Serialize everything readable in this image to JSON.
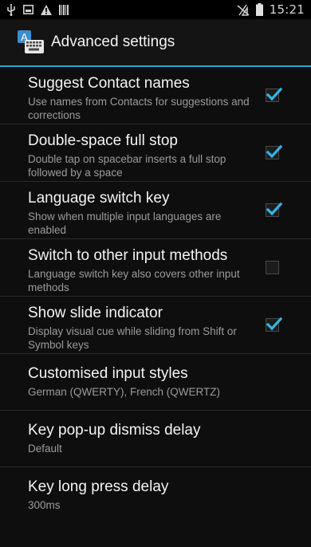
{
  "status_bar": {
    "time": "15:21",
    "icons": [
      "usb-icon",
      "image-icon",
      "warning-icon",
      "barcode-icon",
      "no-signal-icon",
      "battery-icon"
    ]
  },
  "header": {
    "title": "Advanced settings",
    "icon": "keyboard-app-icon"
  },
  "colors": {
    "accent": "#33b5e5",
    "background": "#0e0e0e",
    "summary": "#9b9b9b"
  },
  "settings": [
    {
      "title": "Suggest Contact names",
      "summary": "Use names from Contacts for suggestions and corrections",
      "checked": true
    },
    {
      "title": "Double-space full stop",
      "summary": "Double tap on spacebar inserts a full stop followed by a space",
      "checked": true
    },
    {
      "title": "Language switch key",
      "summary": "Show when multiple input languages are enabled",
      "checked": true
    },
    {
      "title": "Switch to other input methods",
      "summary": "Language switch key also covers other input methods",
      "checked": false
    },
    {
      "title": "Show slide indicator",
      "summary": "Display visual cue while sliding from Shift or Symbol keys",
      "checked": true
    },
    {
      "title": "Customised input styles",
      "summary": "German (QWERTY), French (QWERTZ)"
    },
    {
      "title": "Key pop-up dismiss delay",
      "summary": "Default"
    },
    {
      "title": "Key long press delay",
      "summary": "300ms"
    }
  ]
}
